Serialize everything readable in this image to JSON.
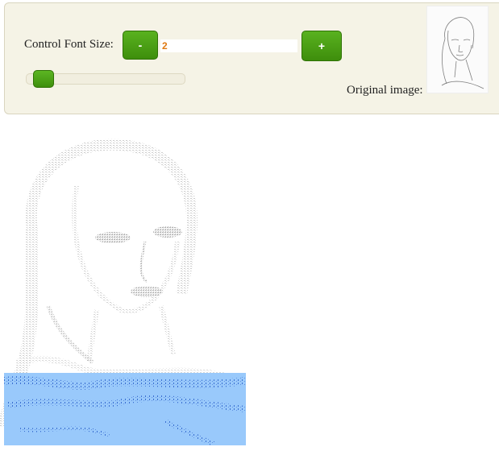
{
  "controls": {
    "font_size_label": "Control Font Size:",
    "minus_label": "-",
    "plus_label": "+",
    "font_size_value": "2",
    "slider_value": 2,
    "slider_min": 1,
    "slider_max": 40,
    "original_label": "Original image:"
  },
  "icons": {
    "thumbnail": "portrait-sketch-icon"
  },
  "colors": {
    "button_green": "#4aa014",
    "panel_bg": "#f5f3e6",
    "value_text": "#e07a12",
    "selection_blue": "#99c9fb"
  }
}
